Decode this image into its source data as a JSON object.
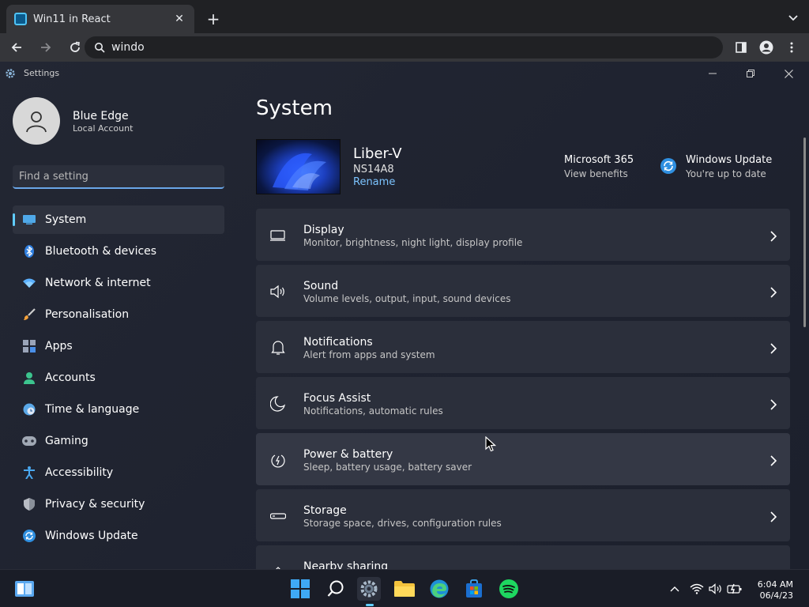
{
  "browser": {
    "tab_title": "Win11 in React",
    "tab_close": "✕",
    "new_tab": "+",
    "address": "windo"
  },
  "window": {
    "title": "Settings"
  },
  "profile": {
    "name": "Blue Edge",
    "account_type": "Local Account"
  },
  "search": {
    "placeholder": "Find a setting"
  },
  "sidebar": {
    "items": [
      {
        "label": "System",
        "icon": "monitor-icon",
        "active": true
      },
      {
        "label": "Bluetooth & devices",
        "icon": "bluetooth-icon"
      },
      {
        "label": "Network & internet",
        "icon": "wifi-icon"
      },
      {
        "label": "Personalisation",
        "icon": "brush-icon"
      },
      {
        "label": "Apps",
        "icon": "apps-icon"
      },
      {
        "label": "Accounts",
        "icon": "person-icon"
      },
      {
        "label": "Time & language",
        "icon": "globe-clock-icon"
      },
      {
        "label": "Gaming",
        "icon": "gamepad-icon"
      },
      {
        "label": "Accessibility",
        "icon": "accessibility-icon"
      },
      {
        "label": "Privacy & security",
        "icon": "shield-icon"
      },
      {
        "label": "Windows Update",
        "icon": "update-icon"
      }
    ]
  },
  "main": {
    "title": "System",
    "device": {
      "name": "Liber-V",
      "model": "NS14A8",
      "rename_label": "Rename"
    },
    "ms365": {
      "title": "Microsoft 365",
      "subtitle": "View benefits"
    },
    "windows_update": {
      "title": "Windows Update",
      "subtitle": "You're up to date"
    },
    "cards": [
      {
        "title": "Display",
        "subtitle": "Monitor, brightness, night light, display profile",
        "icon": "display-icon"
      },
      {
        "title": "Sound",
        "subtitle": "Volume levels, output, input, sound devices",
        "icon": "speaker-icon"
      },
      {
        "title": "Notifications",
        "subtitle": "Alert from apps and system",
        "icon": "bell-icon"
      },
      {
        "title": "Focus Assist",
        "subtitle": "Notifications, automatic rules",
        "icon": "moon-icon"
      },
      {
        "title": "Power & battery",
        "subtitle": "Sleep, battery usage, battery saver",
        "icon": "power-icon"
      },
      {
        "title": "Storage",
        "subtitle": "Storage space, drives, configuration rules",
        "icon": "storage-icon"
      },
      {
        "title": "Nearby sharing",
        "subtitle": "",
        "icon": "share-icon"
      }
    ]
  },
  "taskbar": {
    "time": "6:04 AM",
    "date": "06/4/23"
  },
  "colors": {
    "accent": "#60cdff",
    "window_bg": "#232733",
    "card_bg": "#2b2f3b",
    "taskbar_bg": "#1a1d27"
  }
}
